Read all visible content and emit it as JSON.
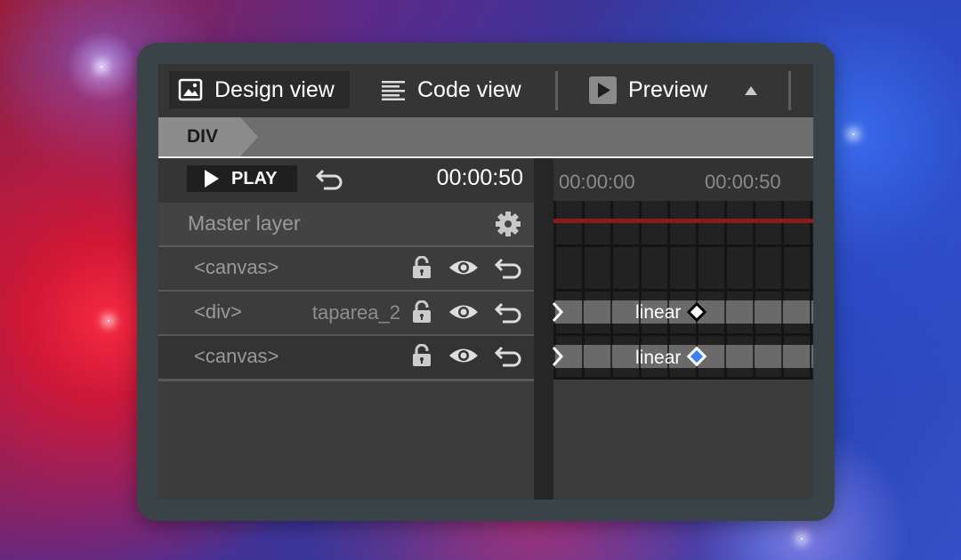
{
  "toolbar": {
    "tabs": [
      {
        "label": "Design view",
        "icon": "image-icon",
        "active": true
      },
      {
        "label": "Code view",
        "icon": "lines-icon",
        "active": false
      },
      {
        "label": "Preview",
        "icon": "play-box-icon",
        "active": false
      }
    ],
    "collapse_icon": "caret-up-icon"
  },
  "breadcrumb": {
    "items": [
      "DIV"
    ]
  },
  "controls": {
    "play_label": "PLAY",
    "timecode": "00:00:50"
  },
  "master_layer": {
    "label": "Master layer",
    "icon": "gear-icon"
  },
  "layers": [
    {
      "tag": "<canvas>",
      "name": ""
    },
    {
      "tag": "<div>",
      "name": "taparea_2"
    },
    {
      "tag": "<canvas>",
      "name": ""
    }
  ],
  "timeline": {
    "ruler": [
      "00:00:00",
      "00:00:50"
    ],
    "tracks": [
      {
        "easing": "linear",
        "keyframe_color": "#ffffff"
      },
      {
        "easing": "linear",
        "keyframe_color": "#3d7ef5"
      }
    ]
  }
}
